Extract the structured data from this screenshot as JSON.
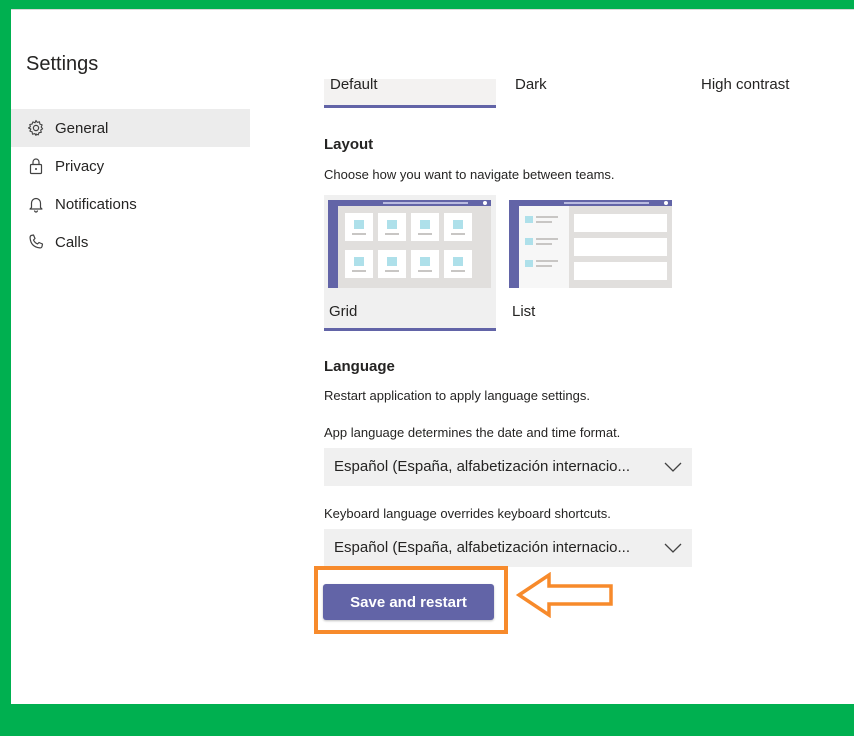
{
  "settings": {
    "title": "Settings",
    "nav": [
      {
        "label": "General",
        "icon": "gear-icon",
        "active": true
      },
      {
        "label": "Privacy",
        "icon": "lock-icon",
        "active": false
      },
      {
        "label": "Notifications",
        "icon": "bell-icon",
        "active": false
      },
      {
        "label": "Calls",
        "icon": "phone-icon",
        "active": false
      }
    ]
  },
  "themes": {
    "options": [
      "Default",
      "Dark",
      "High contrast"
    ],
    "selected": "Default"
  },
  "layout": {
    "heading": "Layout",
    "description": "Choose how you want to navigate between teams.",
    "options": [
      "Grid",
      "List"
    ],
    "selected": "Grid"
  },
  "language": {
    "heading": "Language",
    "restart_note": "Restart application to apply language settings.",
    "app_language_label": "App language determines the date and time format.",
    "app_language_value": "Español (España, alfabetización internacio...",
    "keyboard_language_label": "Keyboard language overrides keyboard shortcuts.",
    "keyboard_language_value": "Español (España, alfabetización internacio..."
  },
  "actions": {
    "save_label": "Save and restart"
  },
  "colors": {
    "accent": "#6264a7",
    "frame_green": "#00b050",
    "annotation_orange": "#f78a2b"
  }
}
